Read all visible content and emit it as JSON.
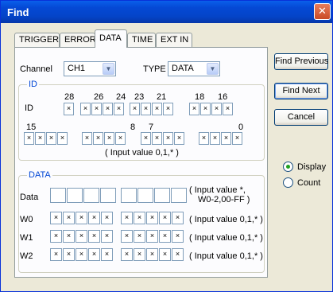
{
  "window": {
    "title": "Find",
    "close_glyph": "✕"
  },
  "tabs": [
    "TRIGGER",
    "ERROR",
    "DATA",
    "TIME",
    "EXT IN"
  ],
  "channel": {
    "label": "Channel",
    "value": "CH1"
  },
  "type": {
    "label": "TYPE",
    "value": "DATA"
  },
  "id_group": {
    "title": "ID",
    "row_label": "ID",
    "top_numbers": [
      "28",
      "26",
      "24",
      "23",
      "21",
      "18",
      "16"
    ],
    "bottom_numbers": [
      "15",
      "8",
      "7",
      "0"
    ],
    "hint": "( Input value 0,1,* )"
  },
  "data_group": {
    "title": "DATA",
    "data_label": "Data",
    "data_hint_1": "( Input value *,",
    "data_hint_2": "W0-2,00-FF )",
    "rows": [
      {
        "label": "W0",
        "hint": "( Input value 0,1,* )"
      },
      {
        "label": "W1",
        "hint": "( Input value 0,1,* )"
      },
      {
        "label": "W2",
        "hint": "( Input value 0,1,* )"
      }
    ]
  },
  "buttons": {
    "find_previous": "Find Previous",
    "find_next": "Find Next",
    "cancel": "Cancel"
  },
  "mode": {
    "display": "Display",
    "count": "Count",
    "selected": "Display"
  },
  "bit_glyph": "×"
}
